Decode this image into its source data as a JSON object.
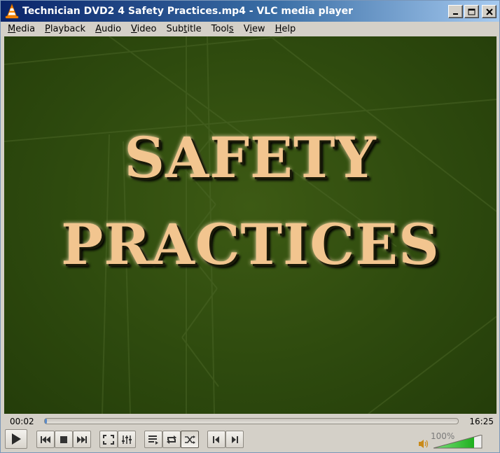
{
  "window": {
    "title": "Technician DVD2 4 Safety Practices.mp4 - VLC media player",
    "title_bar_color": "#0a246a"
  },
  "menu": {
    "items": [
      {
        "label": "Media",
        "accel": "M"
      },
      {
        "label": "Playback",
        "accel": "P"
      },
      {
        "label": "Audio",
        "accel": "A"
      },
      {
        "label": "Video",
        "accel": "V"
      },
      {
        "label": "Subtitle",
        "accel": "t"
      },
      {
        "label": "Tools",
        "accel": "S"
      },
      {
        "label": "View",
        "accel": "i"
      },
      {
        "label": "Help",
        "accel": "H"
      }
    ]
  },
  "video": {
    "line1": "SAFETY",
    "line2": "PRACTICES",
    "text_color": "#f2c58f",
    "background_color": "#2e4a0e"
  },
  "playback": {
    "elapsed": "00:02",
    "total": "16:25",
    "progress_fraction": 0.002
  },
  "volume": {
    "label": "100%",
    "level_fraction": 1.0,
    "fill_color": "#2fc02f"
  },
  "icons": {
    "app": "vlc-cone-icon",
    "minimize": "minimize-icon",
    "maximize": "maximize-icon",
    "close": "close-icon",
    "play": "play-icon",
    "previous": "previous-icon",
    "stop": "stop-icon",
    "next": "next-icon",
    "fullscreen": "fullscreen-icon",
    "extended": "equalizer-icon",
    "playlist": "playlist-icon",
    "loop": "loop-icon",
    "shuffle": "shuffle-icon",
    "frame_back": "frame-back-icon",
    "frame_forward": "frame-forward-icon",
    "speaker": "speaker-icon"
  }
}
